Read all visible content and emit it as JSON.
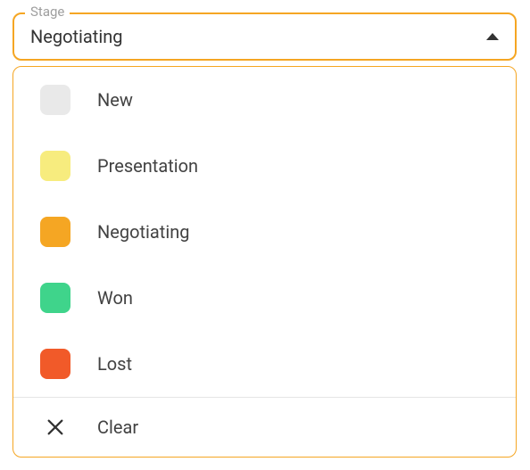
{
  "select": {
    "label": "Stage",
    "value": "Negotiating",
    "options": [
      {
        "label": "New",
        "color": "#e9e9e9"
      },
      {
        "label": "Presentation",
        "color": "#f7ec7e"
      },
      {
        "label": "Negotiating",
        "color": "#f5a623"
      },
      {
        "label": "Won",
        "color": "#3fd48b"
      },
      {
        "label": "Lost",
        "color": "#f15a29"
      }
    ],
    "clear_label": "Clear"
  }
}
